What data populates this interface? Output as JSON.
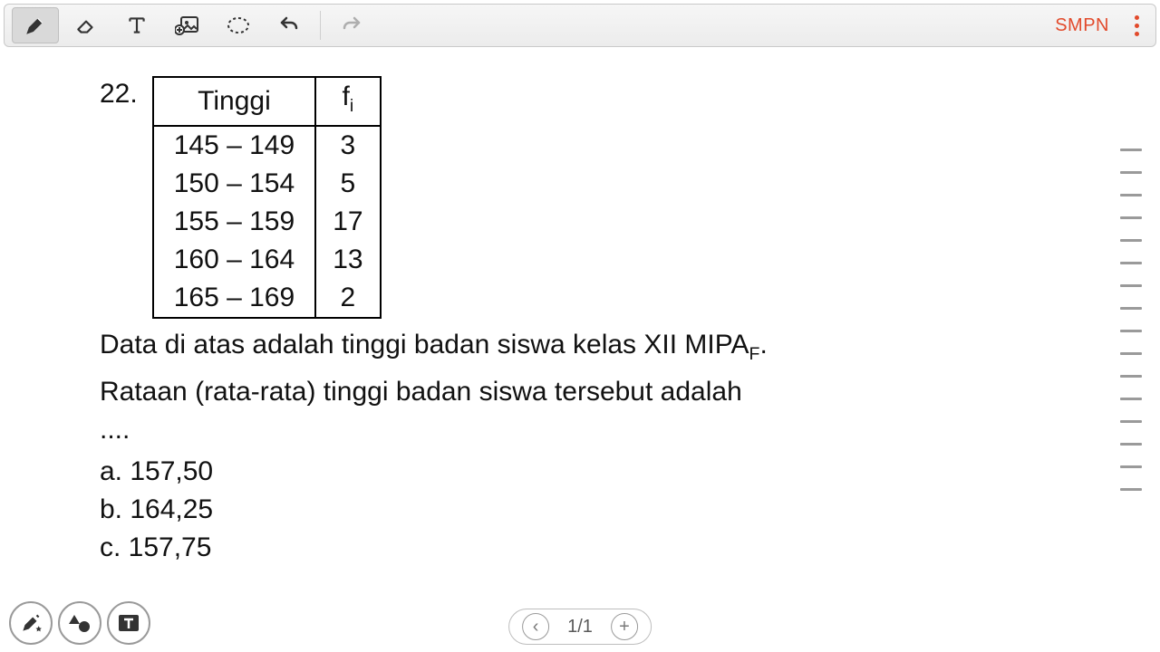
{
  "toolbar": {
    "brand": "SMPN",
    "icons": {
      "pen": "pen-icon",
      "eraser": "eraser-icon",
      "text": "text-icon",
      "image": "add-image-icon",
      "lasso": "lasso-icon",
      "undo": "undo-icon",
      "redo": "redo-icon",
      "more": "more-icon"
    }
  },
  "problem": {
    "number": "22.",
    "table": {
      "headers": {
        "col1": "Tinggi",
        "col2_base": "f",
        "col2_sub": "i"
      },
      "rows": [
        {
          "range": "145 – 149",
          "freq": "3"
        },
        {
          "range": "150 – 154",
          "freq": "5"
        },
        {
          "range": "155 – 159",
          "freq": "17"
        },
        {
          "range": "160 – 164",
          "freq": "13"
        },
        {
          "range": "165 – 169",
          "freq": "2"
        }
      ]
    },
    "body_line1_a": "Data di atas adalah tinggi badan siswa kelas XII MIPA",
    "body_line1_sub": "F",
    "body_line1_b": ".",
    "body_line2": "Rataan (rata-rata) tinggi badan siswa tersebut  adalah",
    "body_line3": "....",
    "options": {
      "a": "a. 157,50",
      "b": "b. 164,25",
      "c": "c. 157,75"
    }
  },
  "pager": {
    "current": "1/1",
    "prev": "‹",
    "add": "+"
  },
  "chart_data": {
    "type": "table",
    "title": "Tinggi badan siswa kelas XII MIPA_F",
    "columns": [
      "Tinggi",
      "f_i"
    ],
    "rows": [
      [
        "145 – 149",
        3
      ],
      [
        "150 – 154",
        5
      ],
      [
        "155 – 159",
        17
      ],
      [
        "160 – 164",
        13
      ],
      [
        "165 – 169",
        2
      ]
    ]
  }
}
